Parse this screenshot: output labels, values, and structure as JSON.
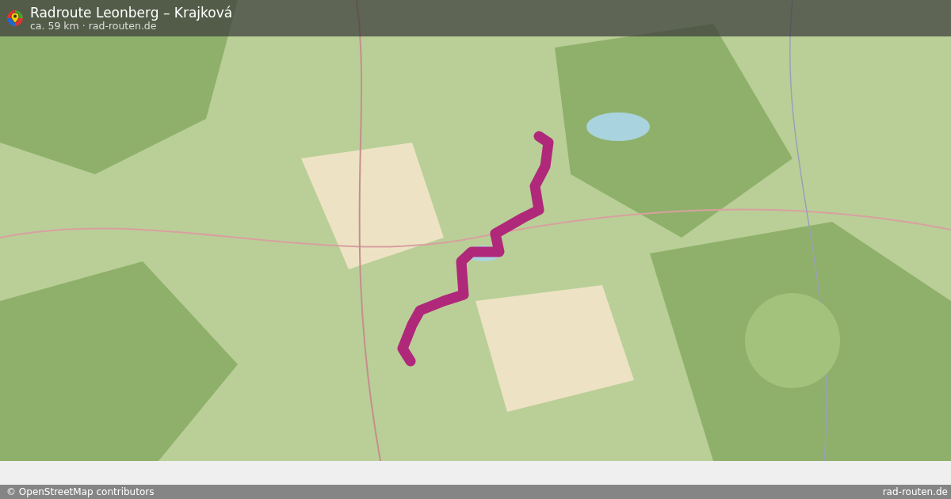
{
  "header": {
    "title": "Radroute Leonberg – Krajková",
    "subtitle": "ca. 59 km · rad-routen.de"
  },
  "footer": {
    "attribution": "© OpenStreetMap contributors",
    "site": "rad-routen.de"
  }
}
